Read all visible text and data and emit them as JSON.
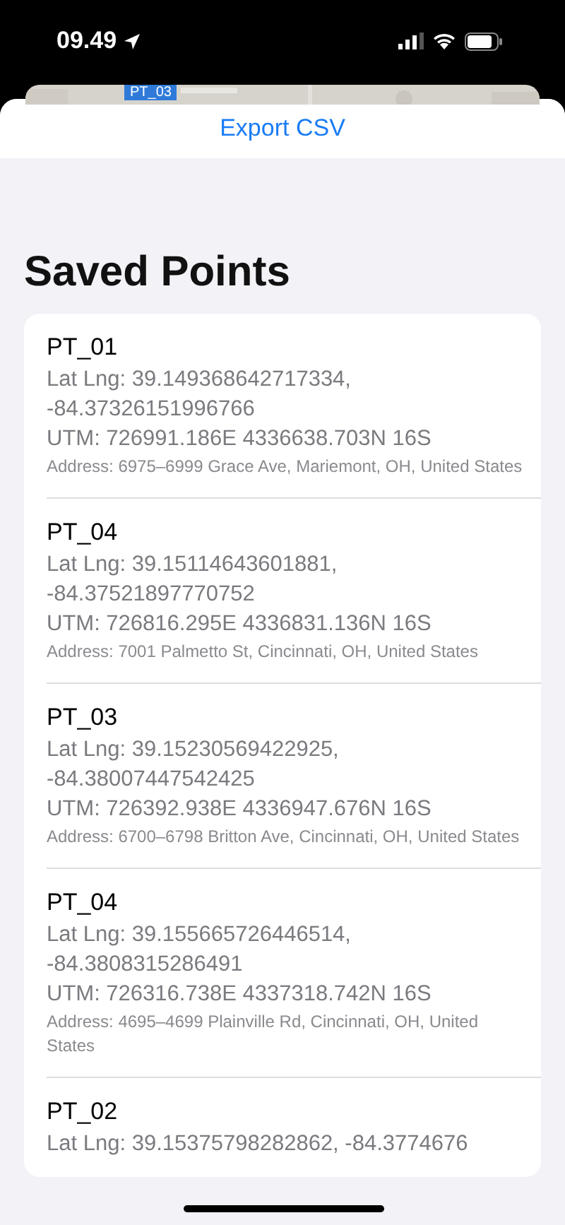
{
  "status_bar": {
    "time": "09.49"
  },
  "map": {
    "kind": "picture",
    "pin_label": "PT_03"
  },
  "sheet": {
    "action": "Export CSV",
    "title": "Saved Points"
  },
  "points": [
    {
      "name": "PT_01",
      "lat_lng": "Lat Lng: 39.149368642717334, -84.37326151996766",
      "utm": "UTM: 726991.186E 4336638.703N 16S",
      "address": "Address: 6975–6999 Grace Ave, Mariemont, OH, United States"
    },
    {
      "name": "PT_04",
      "lat_lng": "Lat Lng: 39.15114643601881, -84.37521897770752",
      "utm": "UTM: 726816.295E 4336831.136N 16S",
      "address": "Address: 7001 Palmetto St, Cincinnati, OH, United States"
    },
    {
      "name": "PT_03",
      "lat_lng": "Lat Lng: 39.15230569422925, -84.38007447542425",
      "utm": "UTM: 726392.938E 4336947.676N 16S",
      "address": "Address: 6700–6798 Britton Ave, Cincinnati, OH, United States"
    },
    {
      "name": "PT_04",
      "lat_lng": "Lat Lng: 39.155665726446514, -84.3808315286491",
      "utm": "UTM: 726316.738E 4337318.742N 16S",
      "address": "Address: 4695–4699 Plainville Rd, Cincinnati, OH, United States"
    },
    {
      "name": "PT_02",
      "lat_lng": "Lat Lng: 39.15375798282862, -84.3774676"
    }
  ]
}
